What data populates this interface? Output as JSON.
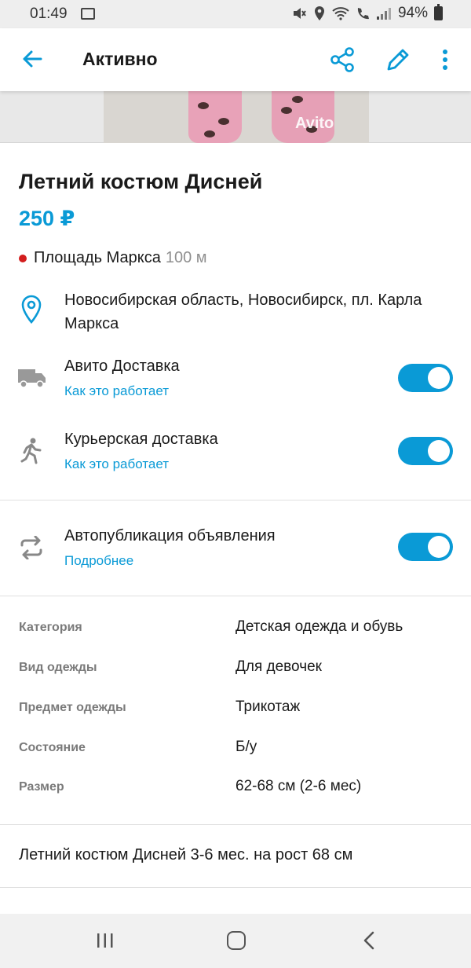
{
  "status_bar": {
    "time": "01:49",
    "battery": "94%"
  },
  "app_bar": {
    "title": "Активно",
    "icons": [
      "back-arrow-icon",
      "share-icon",
      "edit-pencil-icon",
      "more-vert-icon"
    ]
  },
  "photo": {
    "watermark": "Avito"
  },
  "listing": {
    "title": "Летний костюм Дисней",
    "price": "250 ₽",
    "metro_station": "Площадь Маркса",
    "metro_distance": "100 м",
    "address": "Новосибирская область, Новосибирск, пл. Карла Маркса"
  },
  "options": [
    {
      "label": "Авито Доставка",
      "link": "Как это работает",
      "enabled": true,
      "icon": "truck-icon"
    },
    {
      "label": "Курьерская доставка",
      "link": "Как это работает",
      "enabled": true,
      "icon": "courier-walking-icon"
    },
    {
      "label": "Автопубликация объявления",
      "link": "Подробнее",
      "enabled": true,
      "icon": "repeat-icon"
    }
  ],
  "params": [
    {
      "label": "Категория",
      "value": "Детская одежда и обувь"
    },
    {
      "label": "Вид одежды",
      "value": "Для девочек"
    },
    {
      "label": "Предмет одежды",
      "value": "Трикотаж"
    },
    {
      "label": "Состояние",
      "value": "Б/у"
    },
    {
      "label": "Размер",
      "value": "62-68 см (2-6 мес)"
    }
  ],
  "description": "Летний костюм Дисней 3-6 мес. на рост 68 см",
  "colors": {
    "accent": "#0a9ad6",
    "metro_dot": "#d31d1d"
  }
}
